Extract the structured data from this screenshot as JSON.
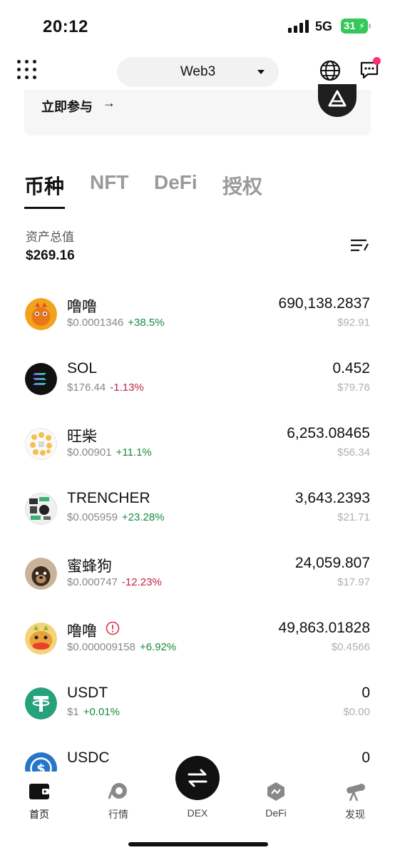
{
  "status_bar": {
    "time": "20:12",
    "network": "5G",
    "battery": "31"
  },
  "header": {
    "network_selector": "Web3"
  },
  "banner": {
    "text": "立即参与",
    "arrow": "→"
  },
  "tabs": [
    {
      "label": "币种",
      "active": true
    },
    {
      "label": "NFT",
      "active": false
    },
    {
      "label": "DeFi",
      "active": false
    },
    {
      "label": "授权",
      "active": false
    }
  ],
  "assets": {
    "label": "资产总值",
    "total": "$269.16"
  },
  "tokens": [
    {
      "name": "噜噜",
      "price": "$0.0001346",
      "change": "+38.5%",
      "amount": "690,138.2837",
      "value": "$92.91"
    },
    {
      "name": "SOL",
      "price": "$176.44",
      "change": "-1.13%",
      "amount": "0.452",
      "value": "$79.76"
    },
    {
      "name": "旺柴",
      "price": "$0.00901",
      "change": "+11.1%",
      "amount": "6,253.08465",
      "value": "$56.34"
    },
    {
      "name": "TRENCHER",
      "price": "$0.005959",
      "change": "+23.28%",
      "amount": "3,643.2393",
      "value": "$21.71"
    },
    {
      "name": "蜜蜂狗",
      "price": "$0.000747",
      "change": "-12.23%",
      "amount": "24,059.807",
      "value": "$17.97"
    },
    {
      "name": "噜噜",
      "price": "$0.000009158",
      "change": "+6.92%",
      "amount": "49,863.01828",
      "value": "$0.4566"
    },
    {
      "name": "USDT",
      "price": "$1",
      "change": "+0.01%",
      "amount": "0",
      "value": "$0.00"
    },
    {
      "name": "USDC",
      "price": "",
      "change": "",
      "amount": "0",
      "value": ""
    }
  ],
  "bottom_nav": [
    {
      "label": "首页",
      "icon": "wallet-icon",
      "active": true
    },
    {
      "label": "行情",
      "icon": "market-icon",
      "active": false
    },
    {
      "label": "DEX",
      "icon": "swap-icon",
      "active": false
    },
    {
      "label": "DeFi",
      "icon": "defi-icon",
      "active": false
    },
    {
      "label": "发现",
      "icon": "telescope-icon",
      "active": false
    }
  ],
  "colors": {
    "up": "#198a3b",
    "down": "#c0254a",
    "accent": "#111111",
    "badge": "#ff2d73"
  }
}
